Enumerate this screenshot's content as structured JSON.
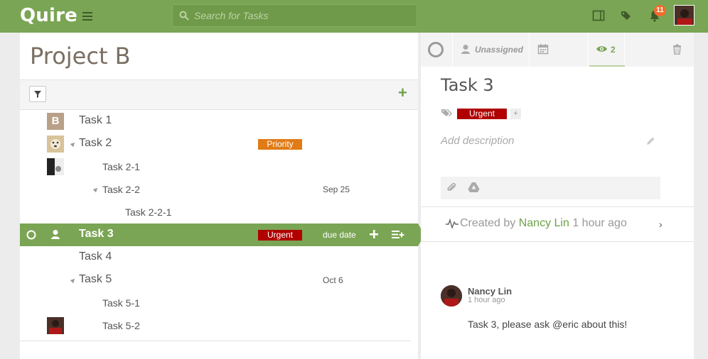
{
  "app": {
    "logo": "Quire"
  },
  "search": {
    "placeholder": "Search for Tasks"
  },
  "notifications": {
    "count": "11"
  },
  "project": {
    "title": "Project B"
  },
  "tasks": [
    {
      "name": "Task 1",
      "avatar": "B"
    },
    {
      "name": "Task 2",
      "tag": "Priority"
    },
    {
      "name": "Task 2-1"
    },
    {
      "name": "Task 2-2",
      "due": "Sep 25"
    },
    {
      "name": "Task 2-2-1"
    },
    {
      "name": "Task 3",
      "tag": "Urgent",
      "due": "due date"
    },
    {
      "name": "Task 4"
    },
    {
      "name": "Task 5",
      "due": "Oct 6"
    },
    {
      "name": "Task 5-1"
    },
    {
      "name": "Task 5-2"
    }
  ],
  "tag_colors": {
    "Priority": "#e07b16",
    "Urgent": "#b00000"
  },
  "detail": {
    "assignee": "Unassigned",
    "watch_count": "2",
    "title": "Task 3",
    "tag": "Urgent",
    "tag_add": "+",
    "description_placeholder": "Add description",
    "created_prefix": "Created by",
    "created_author": "Nancy Lin",
    "created_time": "1 hour ago",
    "chevron": "›",
    "comment": {
      "author": "Nancy Lin",
      "time": "1 hour ago",
      "text": "Task 3, please ask @eric about this!"
    }
  }
}
